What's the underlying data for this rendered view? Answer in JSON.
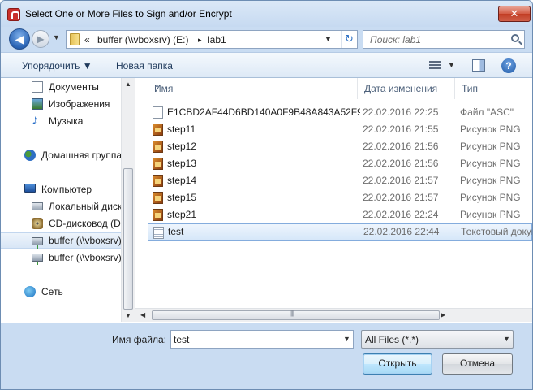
{
  "window": {
    "title": "Select One or More Files to Sign and/or Encrypt",
    "close": "✕"
  },
  "nav": {
    "back": "◀",
    "forward": "▶",
    "history": "▼",
    "breadcrumb_overflow": "«",
    "path": [
      "buffer (\\\\vboxsrv) (E:)",
      "lab1"
    ],
    "separator": "▸",
    "addr_drop": "▼",
    "refresh": "↻",
    "search_placeholder": "Поиск: lab1"
  },
  "toolbar": {
    "organize": "Упорядочить ▼",
    "new_folder": "Новая папка",
    "view_drop": "▼",
    "help": "?"
  },
  "sidebar": {
    "items": [
      {
        "label": "Документы",
        "icon": "documents-icon"
      },
      {
        "label": "Изображения",
        "icon": "pictures-icon"
      },
      {
        "label": "Музыка",
        "icon": "music-icon"
      },
      {
        "label": "Домашняя группа",
        "icon": "homegroup-icon"
      },
      {
        "label": "Компьютер",
        "icon": "computer-icon"
      },
      {
        "label": "Локальный диск (C:)",
        "icon": "hard-drive-icon"
      },
      {
        "label": "CD-дисковод (D:)",
        "icon": "cd-drive-icon"
      },
      {
        "label": "buffer (\\\\vboxsrv) (E:)",
        "icon": "network-drive-icon",
        "selected": true
      },
      {
        "label": "buffer (\\\\vboxsrv) (F:)",
        "icon": "network-drive-icon"
      },
      {
        "label": "Сеть",
        "icon": "network-icon"
      }
    ]
  },
  "filelist": {
    "columns": [
      "Имя",
      "Дата изменения",
      "Тип"
    ],
    "sort_indicator": "▲",
    "rows": [
      {
        "name": "E1CBD2AF44D6BD140A0F9B48A843A52F9...",
        "date": "22.02.2016 22:25",
        "type": "Файл \"ASC\"",
        "icon": "file-icon"
      },
      {
        "name": "step11",
        "date": "22.02.2016 21:55",
        "type": "Рисунок PNG",
        "icon": "png-image-icon"
      },
      {
        "name": "step12",
        "date": "22.02.2016 21:56",
        "type": "Рисунок PNG",
        "icon": "png-image-icon"
      },
      {
        "name": "step13",
        "date": "22.02.2016 21:56",
        "type": "Рисунок PNG",
        "icon": "png-image-icon"
      },
      {
        "name": "step14",
        "date": "22.02.2016 21:57",
        "type": "Рисунок PNG",
        "icon": "png-image-icon"
      },
      {
        "name": "step15",
        "date": "22.02.2016 21:57",
        "type": "Рисунок PNG",
        "icon": "png-image-icon"
      },
      {
        "name": "step21",
        "date": "22.02.2016 22:24",
        "type": "Рисунок PNG",
        "icon": "png-image-icon"
      },
      {
        "name": "test",
        "date": "22.02.2016 22:44",
        "type": "Текстовый документ",
        "icon": "text-file-icon",
        "selected": true
      }
    ]
  },
  "scroll": {
    "up": "▲",
    "down": "▼",
    "left": "◀",
    "right": "▶"
  },
  "bottom": {
    "filename_label": "Имя файла:",
    "filename_value": "test",
    "filename_drop": "▼",
    "filter_value": "All Files (*.*)",
    "filter_drop": "▼",
    "open_label": "Открыть",
    "cancel_label": "Отмена"
  }
}
